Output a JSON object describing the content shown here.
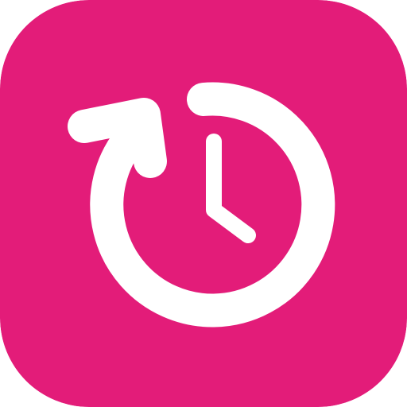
{
  "app_icon": {
    "name": "history-icon",
    "background_color": "#E31C79",
    "glyph_color": "#FFFFFF"
  }
}
